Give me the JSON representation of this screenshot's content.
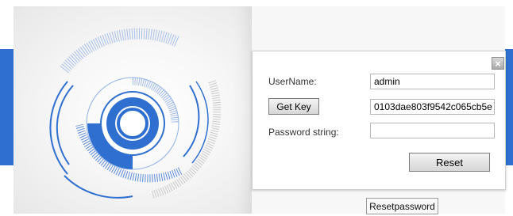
{
  "colors": {
    "accent_blue": "#2f6fd0",
    "art_blue": "#2f6fd0",
    "art_light_blue": "#8fb0e6"
  },
  "dialog": {
    "close_icon": "close-icon",
    "username_label": "UserName:",
    "username_value": "admin",
    "get_key_label": "Get Key",
    "key_value": "0103dae803f9542c065cb5e",
    "password_label": "Password string:",
    "password_value": "",
    "reset_label": "Reset"
  },
  "footer": {
    "reset_password_label": "Resetpassword"
  }
}
